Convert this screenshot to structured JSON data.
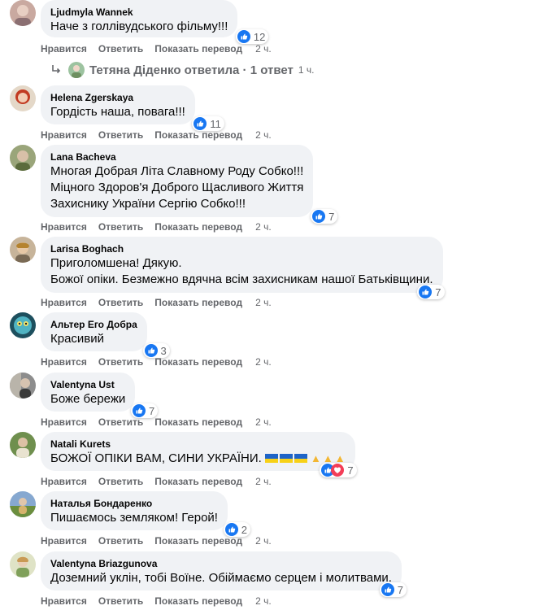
{
  "action_labels": {
    "like": "Нравится",
    "reply": "Ответить",
    "translate": "Показать перевод"
  },
  "colors": {
    "like_blue": "#1877f2",
    "love_red": "#f33e58",
    "bubble_bg": "#f0f2f5",
    "meta_gray": "#65676b"
  },
  "comments": [
    {
      "author": "Ljudmyla Wannek",
      "lines": [
        "Наче з голлівудського фільму!!!"
      ],
      "reactions": [
        "like"
      ],
      "count": "12",
      "time": "2 ч."
    },
    {
      "author": "Helena Zgerskaya",
      "lines": [
        "Гордість наша, повага!!!"
      ],
      "reactions": [
        "like"
      ],
      "count": "11",
      "time": "2 ч."
    },
    {
      "author": "Lana Bacheva",
      "lines": [
        "Многая Добрая Літа Славному Роду Собко!!!",
        "Міцного Здоров'я Доброго Щасливого Життя",
        "Захиснику України Сергію Собко!!!"
      ],
      "reactions": [
        "like"
      ],
      "count": "7",
      "time": "2 ч."
    },
    {
      "author": "Larisa Boghach",
      "lines": [
        "Приголомшена! Дякую.",
        "Божої опіки. Безмежно вдячна всім захисникам нашої Батьківщини."
      ],
      "reactions": [
        "like"
      ],
      "count": "7",
      "time": "2 ч."
    },
    {
      "author": "Альтер Его Добра",
      "lines": [
        "Красивий"
      ],
      "reactions": [
        "like"
      ],
      "count": "3",
      "time": "2 ч."
    },
    {
      "author": "Valentyna Ust",
      "lines": [
        "Боже бережи"
      ],
      "reactions": [
        "like"
      ],
      "count": "7",
      "time": "2 ч."
    },
    {
      "author": "Natali Kurets",
      "lines": [
        "БОЖОЇ ОПІКИ ВАМ, СИНИ УКРАЇНИ."
      ],
      "emoji": [
        "flag-ukraine-icon",
        "flag-ukraine-icon",
        "flag-ukraine-icon",
        "praying-hands-icon",
        "praying-hands-icon",
        "praying-hands-icon"
      ],
      "reactions": [
        "like",
        "love"
      ],
      "count": "7",
      "time": "2 ч."
    },
    {
      "author": "Наталья Бондаренко",
      "lines": [
        "Пишаємось земляком! Герой!"
      ],
      "reactions": [
        "like"
      ],
      "count": "2",
      "time": "2 ч."
    },
    {
      "author": "Valentyna Briazgunova",
      "lines": [
        "Доземний уклін, тобі Воїне. Обіймаємо серцем і молитвами."
      ],
      "reactions": [
        "like"
      ],
      "count": "7",
      "time": "2 ч."
    }
  ],
  "reply_summary": {
    "text": "Тетяна Діденко ответила · 1 ответ",
    "time": "1 ч."
  }
}
